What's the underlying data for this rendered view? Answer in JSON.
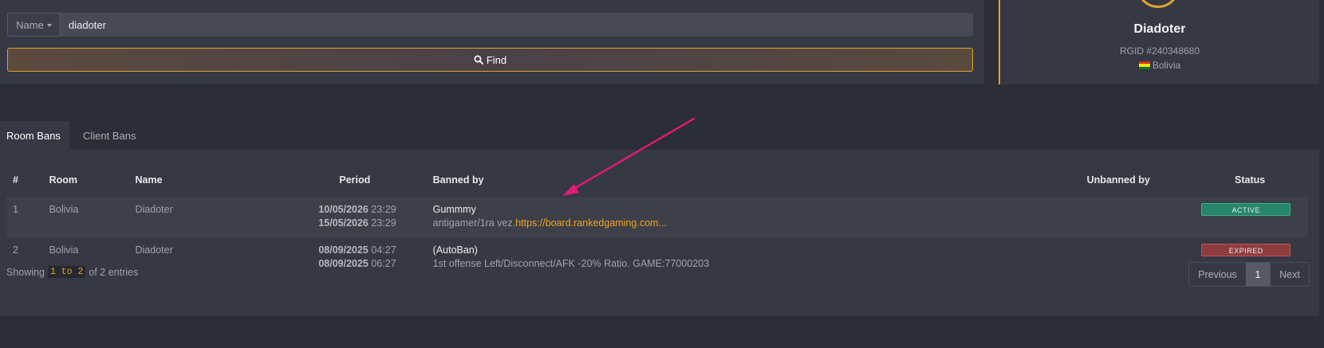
{
  "search": {
    "field_selector_label": "Name",
    "query_value": "diadoter",
    "find_label": "Find"
  },
  "profile": {
    "name": "Diadoter",
    "rgid": "RGID #240348680",
    "country": "Bolivia",
    "flag_colors": [
      "#d52b1e",
      "#f9e300",
      "#007934"
    ]
  },
  "tabs": [
    {
      "label": "Room Bans",
      "active": true
    },
    {
      "label": "Client Bans",
      "active": false
    }
  ],
  "table": {
    "columns": [
      "#",
      "Room",
      "Name",
      "Period",
      "Banned by",
      "Unbanned by",
      "Status"
    ],
    "rows": [
      {
        "index": "1",
        "room": "Bolivia",
        "name": "Diadoter",
        "start_date": "10/05/2026",
        "start_time": "23:29",
        "end_date": "15/05/2026",
        "end_time": "23:29",
        "banned_by": "Gummmy",
        "reason_text": "antigamer/1ra vez.",
        "reason_link": "https://board.rankedgaming.com...",
        "unbanned_by": "",
        "status": "ACTIVE"
      },
      {
        "index": "2",
        "room": "Bolivia",
        "name": "Diadoter",
        "start_date": "08/09/2025",
        "start_time": "04:27",
        "end_date": "08/09/2025",
        "end_time": "06:27",
        "banned_by": "(AutoBan)",
        "reason_text": "1st offense Left/Disconnect/AFK -20% Ratio. GAME:77000203",
        "reason_link": "",
        "unbanned_by": "",
        "status": "EXPIRED"
      }
    ]
  },
  "footer": {
    "showing_prefix": "Showing",
    "showing_range": "1 to 2",
    "showing_suffix": "of 2 entries"
  },
  "pagination": {
    "previous_label": "Previous",
    "current_page": "1",
    "next_label": "Next"
  },
  "colors": {
    "accent": "#e0a42c",
    "link": "#f0a220",
    "annotation_arrow": "#e6187a",
    "status_active": "#27866a",
    "status_expired": "#8f3c3f"
  },
  "icons": {
    "find": "search-icon",
    "dropdown": "chevron-down-icon"
  }
}
